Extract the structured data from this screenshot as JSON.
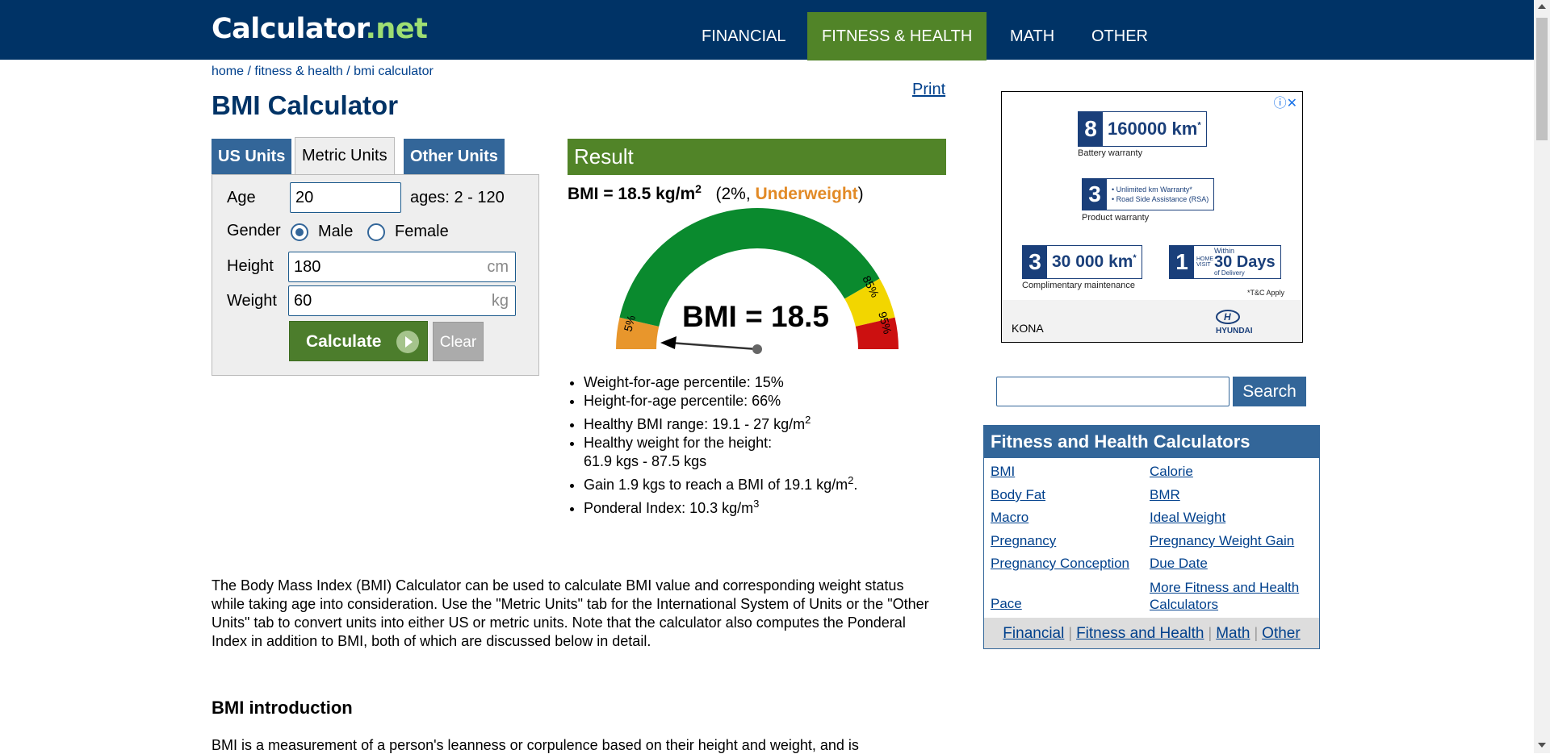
{
  "header": {
    "logo_main": "Calculator",
    "logo_dot_net": ".net",
    "nav": [
      "FINANCIAL",
      "FITNESS & HEALTH",
      "MATH",
      "OTHER"
    ],
    "active_nav": "FITNESS & HEALTH",
    "colors": {
      "bar": "#003366",
      "active": "#518428",
      "logo_accent": "#9ede73"
    }
  },
  "breadcrumb": [
    "home",
    "fitness & health",
    "bmi calculator"
  ],
  "breadcrumb_sep": " / ",
  "page_title": "BMI Calculator",
  "print_label": "Print",
  "tabs": [
    "US Units",
    "Metric Units",
    "Other Units"
  ],
  "active_tab": "Metric Units",
  "form": {
    "age_label": "Age",
    "age_value": "20",
    "age_hint": "ages: 2 - 120",
    "gender_label": "Gender",
    "male_label": "Male",
    "female_label": "Female",
    "gender_selected": "Male",
    "height_label": "Height",
    "height_value": "180",
    "height_unit": "cm",
    "weight_label": "Weight",
    "weight_value": "60",
    "weight_unit": "kg",
    "calculate_label": "Calculate",
    "clear_label": "Clear"
  },
  "result": {
    "title": "Result",
    "bmi_text": "BMI = 18.5 kg/m",
    "bmi_sup": "2",
    "percent_text": "(2%, ",
    "category": "Underweight",
    "close_paren": ")",
    "gauge_label": "BMI = 18.5",
    "gauge_ticks": [
      "5%",
      "85%",
      "95%"
    ],
    "gauge_colors": {
      "underweight": "#e8962c",
      "healthy": "#0a8a2e",
      "overweight": "#f2d600",
      "obese": "#cc1010"
    },
    "items": [
      {
        "text": "Weight-for-age percentile: 15%"
      },
      {
        "text": "Height-for-age percentile: 66%"
      },
      {
        "text": "Healthy BMI range: 19.1 - 27 kg/m",
        "sup": "2"
      },
      {
        "text": "Healthy weight for the height:",
        "line2": "61.9 kgs - 87.5 kgs"
      },
      {
        "text": "Gain 1.9 kgs to reach a BMI of 19.1 kg/m",
        "sup": "2",
        "tail": "."
      },
      {
        "text": "Ponderal Index: 10.3 kg/m",
        "sup": "3"
      }
    ]
  },
  "description": "The Body Mass Index (BMI) Calculator can be used to calculate BMI value and corresponding weight status while taking age into consideration. Use the \"Metric Units\" tab for the International System of Units or the \"Other Units\" tab to convert units into either US or metric units. Note that the calculator also computes the Ponderal Index in addition to BMI, both of which are discussed below in detail.",
  "section_heading": "BMI introduction",
  "section_cut_text": "BMI is a measurement of a person's leanness or corpulence based on their height and weight, and is",
  "ad": {
    "row1_num": "8",
    "row1_years": "YEARS",
    "row1_value": "160000 km",
    "row1_star": "*",
    "row1_caption": "Battery warranty",
    "row2_num": "3",
    "row2_years": "YEARS",
    "row2_bullet1": "• Unlimited km Warranty*",
    "row2_bullet2": "• Road Side Assistance (RSA)",
    "row2_caption": "Product warranty",
    "row3_num": "3",
    "row3_years": "YEARS",
    "row3_value": "30 000 km",
    "row3_star": "*",
    "row4_num": "1",
    "row4_small": "HOME VISIT",
    "row4_within": "Within",
    "row4_value": "30 Days",
    "row4_sub": "of Delivery",
    "row3_caption": "Complimentary maintenance",
    "tc": "*T&C Apply",
    "model": "KONA",
    "brand": "HYUNDAI"
  },
  "search": {
    "button": "Search",
    "value": ""
  },
  "sidebar": {
    "title": "Fitness and Health Calculators",
    "links_left": [
      "BMI",
      "Body Fat",
      "Macro",
      "Pregnancy",
      "Pregnancy Conception",
      "Pace"
    ],
    "links_right": [
      "Calorie",
      "BMR",
      "Ideal Weight",
      "Pregnancy Weight Gain",
      "Due Date",
      "More Fitness and Health Calculators"
    ],
    "footer": [
      "Financial",
      "Fitness and Health",
      "Math",
      "Other"
    ],
    "footer_sep": "|"
  }
}
